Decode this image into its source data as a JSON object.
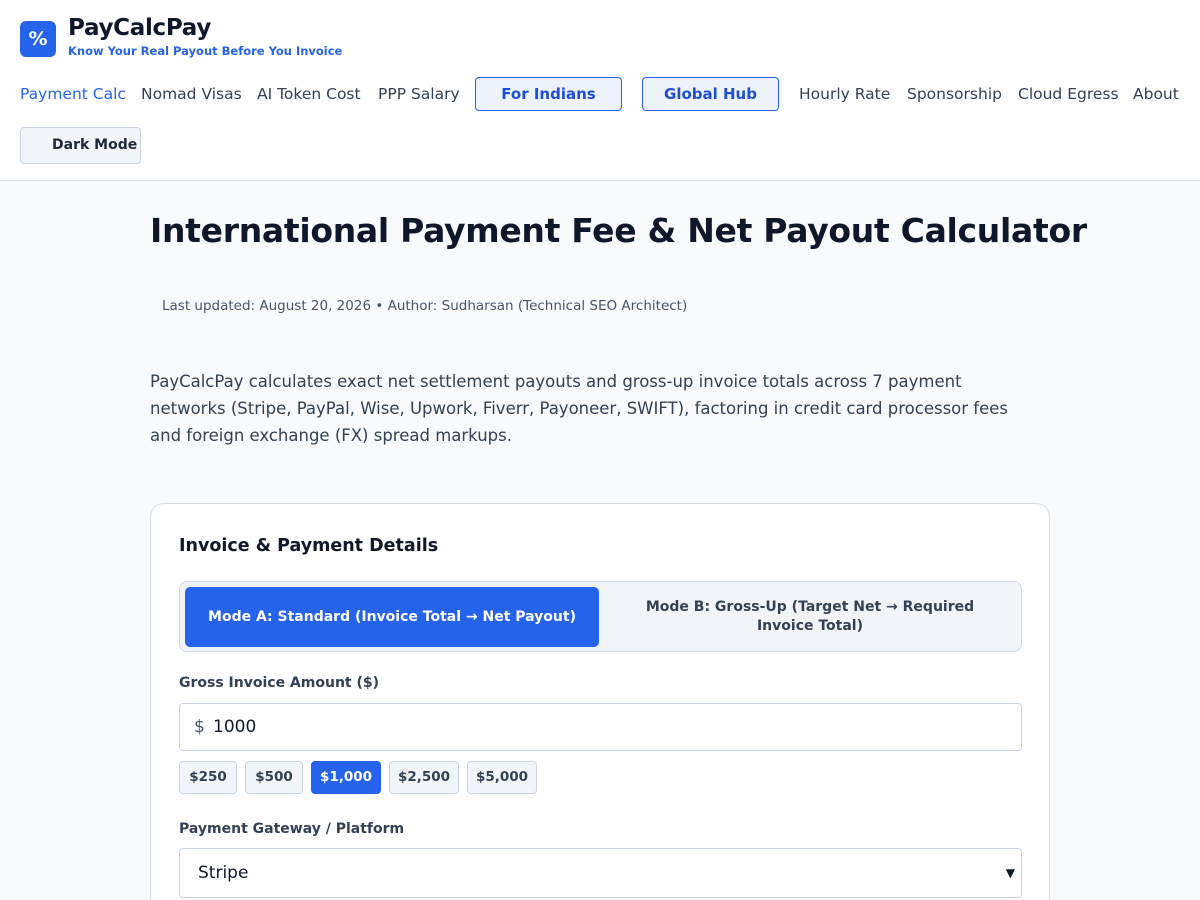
{
  "brand": {
    "logo_glyph": "%",
    "name": "PayCalcPay",
    "tagline": "Know Your Real Payout Before You Invoice"
  },
  "nav": {
    "items": [
      {
        "label": "Payment Calc",
        "active": true
      },
      {
        "label": "Nomad Visas"
      },
      {
        "label": "AI Token Cost"
      },
      {
        "label": "PPP Salary"
      },
      {
        "label": "For Indians",
        "style": "button"
      },
      {
        "label": "Global Hub",
        "style": "button"
      },
      {
        "label": "Hourly Rate"
      },
      {
        "label": "Sponsorship"
      },
      {
        "label": "Cloud Egress"
      },
      {
        "label": "About"
      }
    ],
    "dark_mode_label": "Dark Mode"
  },
  "page": {
    "title": "International Payment Fee & Net Payout Calculator",
    "meta": "Last updated: August 20, 2026 • Author: Sudharsan (Technical SEO Architect)",
    "intro": "PayCalcPay calculates exact net settlement payouts and gross-up invoice totals across 7 payment networks (Stripe, PayPal, Wise, Upwork, Fiverr, Payoneer, SWIFT), factoring in credit card processor fees and foreign exchange (FX) spread markups."
  },
  "calculator": {
    "title": "Invoice & Payment Details",
    "modes": {
      "a": "Mode A: Standard (Invoice Total → Net Payout)",
      "b": "Mode B: Gross-Up (Target Net → Required Invoice Total)",
      "selected": "a"
    },
    "amount_label": "Gross Invoice Amount ($)",
    "currency_symbol": "$",
    "amount_value": "1000",
    "presets": [
      "$250",
      "$500",
      "$1,000",
      "$2,500",
      "$5,000"
    ],
    "selected_preset": "$1,000",
    "gateway_label": "Payment Gateway / Platform",
    "gateway_value": "Stripe"
  },
  "colors": {
    "accent": "#2563eb",
    "text": "#0f172a",
    "background": "#f8fafc"
  }
}
